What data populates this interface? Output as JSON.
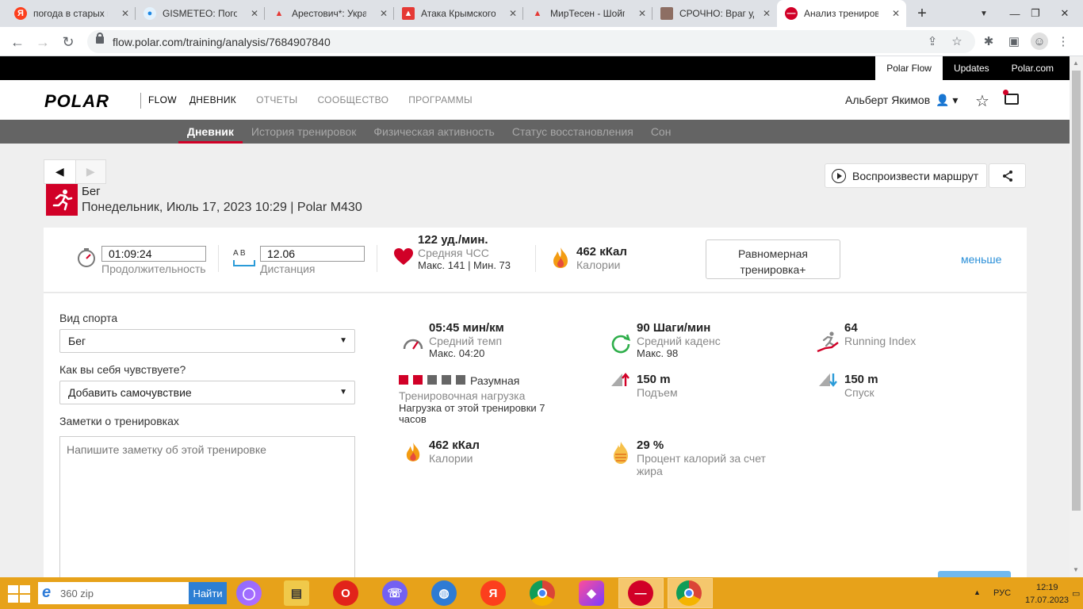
{
  "browser": {
    "tabs": [
      {
        "title": "погода в старых м",
        "fav_color": "#fc3f1d",
        "fav_glyph": "Я"
      },
      {
        "title": "GISMETEO: Погода",
        "fav_color": "#1e88e5",
        "fav_glyph": "●"
      },
      {
        "title": "Арестович*: Укра",
        "fav_color": "#e53935",
        "fav_glyph": "🔥"
      },
      {
        "title": "Атака Крымского",
        "fav_color": "#e53935",
        "fav_glyph": "▲"
      },
      {
        "title": "МирТесен - Шойг",
        "fav_color": "#e53935",
        "fav_glyph": "🔥"
      },
      {
        "title": "СРОЧНО: Враг уд",
        "fav_color": "#8d6e63",
        "fav_glyph": "■"
      },
      {
        "title": "Анализ трениров",
        "fav_color": "#d10027",
        "fav_glyph": "—"
      }
    ],
    "new_tab_glyph": "+",
    "url": "flow.polar.com/training/analysis/7684907840"
  },
  "polar": {
    "top_links": [
      "Polar Flow",
      "Updates",
      "Polar.com"
    ],
    "logo": "POLAR",
    "logo_suffix": "FLOW",
    "main_nav": [
      "ДНЕВНИК",
      "ОТЧЕТЫ",
      "СООБЩЕСТВО",
      "ПРОГРАММЫ"
    ],
    "user_name": "Альберт Якимов",
    "sub_nav": [
      "Дневник",
      "История тренировок",
      "Физическая активность",
      "Статус восстановления",
      "Сон"
    ]
  },
  "session": {
    "sport": "Бег",
    "date_line": "Понедельник, Июль 17, 2023 10:29 | Polar M430",
    "play_route": "Воспроизвести маршрут",
    "duration": "01:09:24",
    "duration_label": "Продолжительность",
    "distance_ab": "A  B",
    "distance": "12.06",
    "distance_label": "Дистанция",
    "hr_value": "122 уд./мин.",
    "hr_label": "Средняя ЧСС",
    "hr_minmax": "Макс. 141  |  Мин. 73",
    "calories": "462 кКал",
    "calories_label": "Калории",
    "benefit": "Равномерная тренировка+",
    "less_link": "меньше"
  },
  "form": {
    "sport_label": "Вид спорта",
    "sport_value": "Бег",
    "feeling_label": "Как вы себя чувствуете?",
    "feeling_value": "Добавить самочувствие",
    "notes_label": "Заметки о тренировках",
    "notes_placeholder": "Напишите заметку об этой тренировке"
  },
  "metrics": {
    "pace_value": "05:45 мин/км",
    "pace_label": "Средний темп",
    "pace_max": "Макс. 04:20",
    "cadence_value": "90 Шаги/мин",
    "cadence_label": "Средний каденс",
    "cadence_max": "Макс. 98",
    "ri_value": "64",
    "ri_label": "Running Index",
    "load_level": 2,
    "load_total": 5,
    "load_word": "Разумная",
    "load_label": "Тренировочная нагрузка",
    "load_desc": "Нагрузка от этой тренировки 7 часов",
    "ascent_value": "150 m",
    "ascent_label": "Подъем",
    "descent_value": "150 m",
    "descent_label": "Спуск",
    "cal_value": "462 кКал",
    "cal_label": "Калории",
    "fat_value": "29 %",
    "fat_label": "Процент калорий за счет жира"
  },
  "taskbar": {
    "search_text": "360 zip",
    "search_button": "Найти",
    "lang": "РУС",
    "time": "12:19",
    "date": "17.07.2023"
  }
}
